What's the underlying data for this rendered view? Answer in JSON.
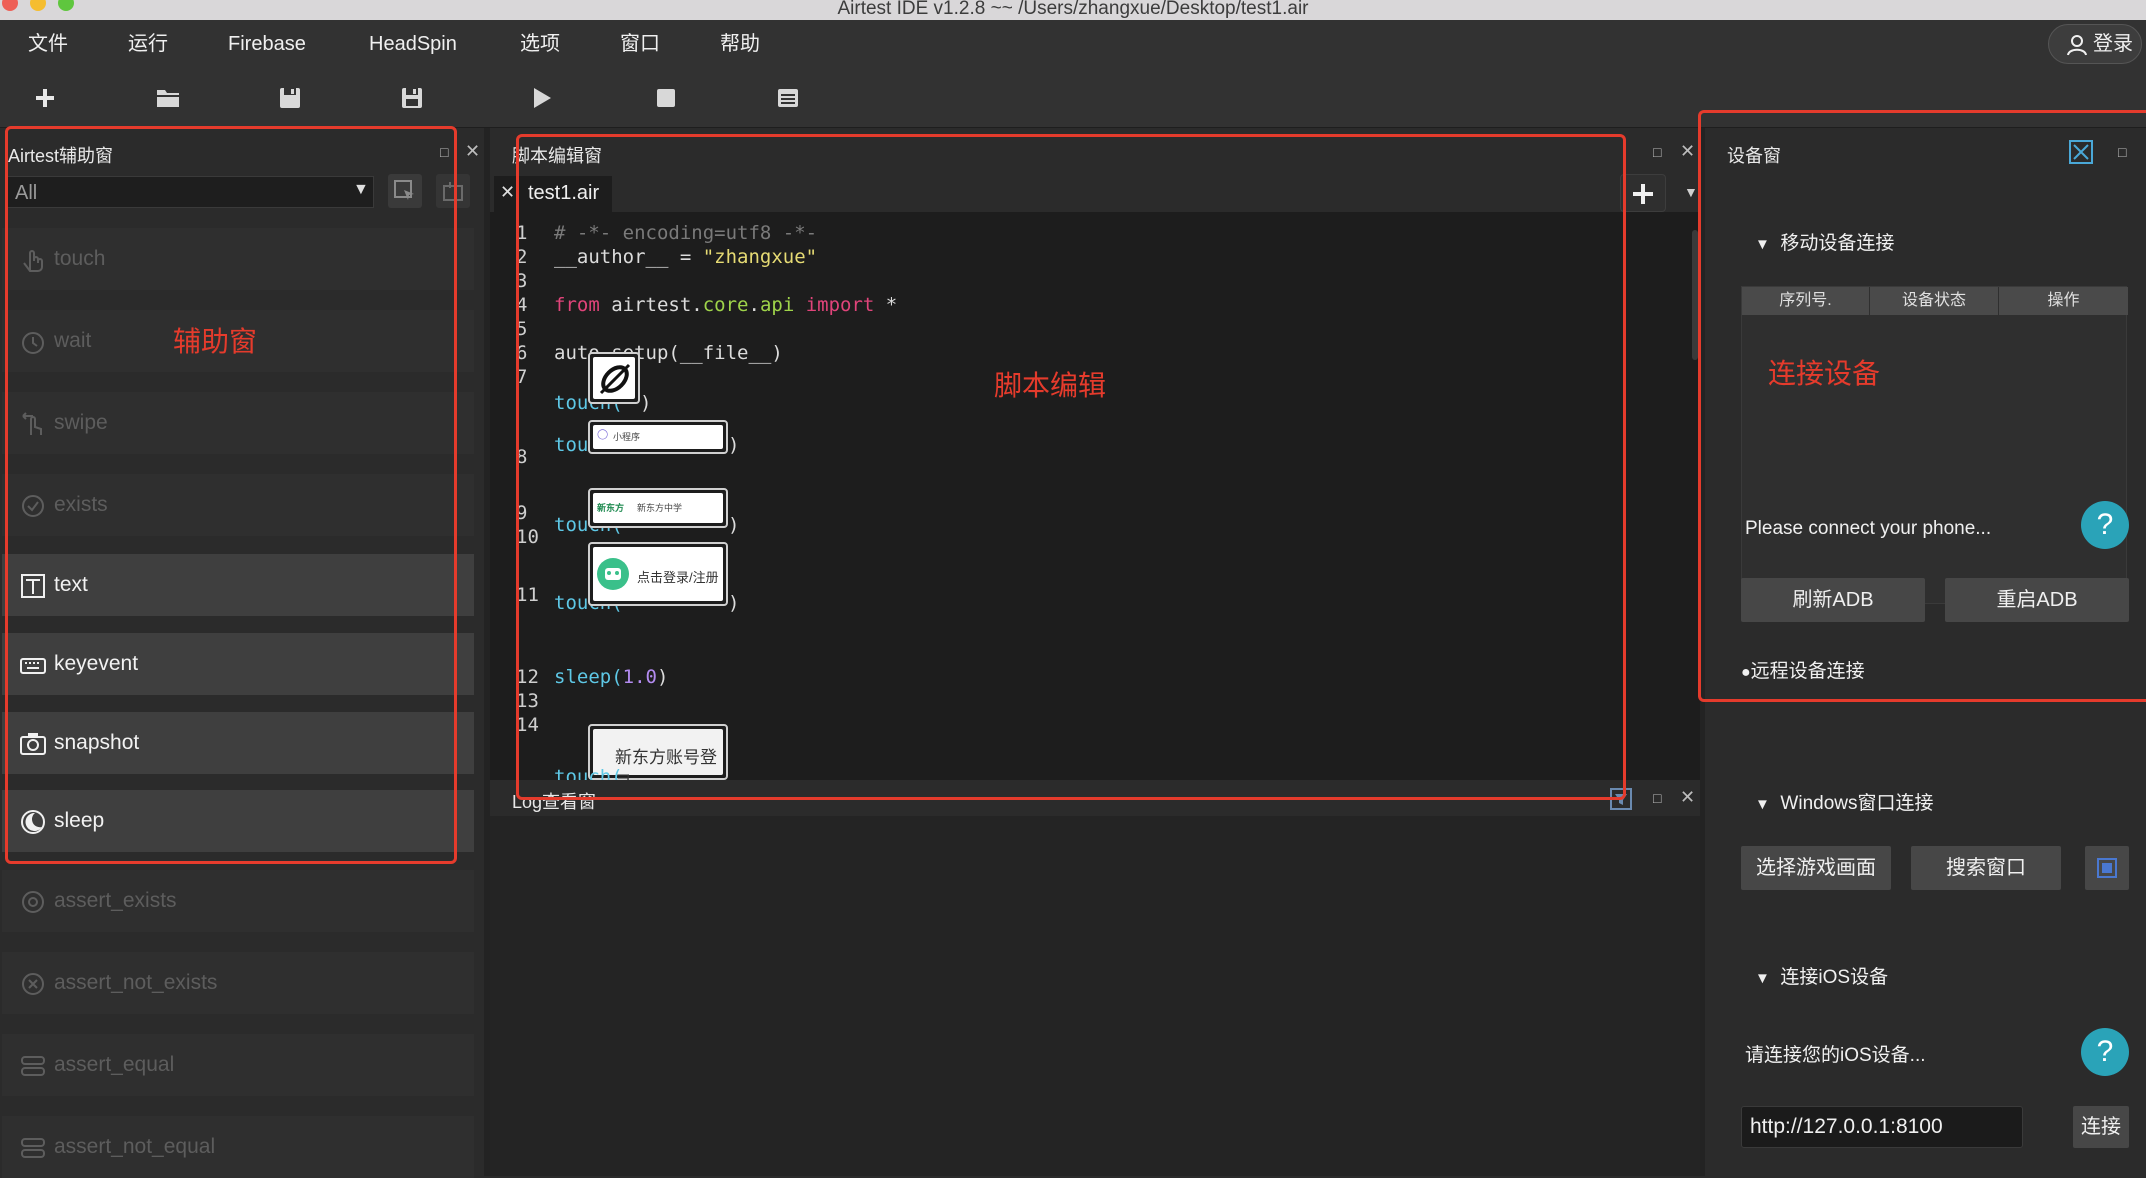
{
  "window": {
    "title": "Airtest IDE v1.2.8 ~~ /Users/zhangxue/Desktop/test1.air"
  },
  "menu": [
    "文件",
    "运行",
    "Firebase",
    "HeadSpin",
    "选项",
    "窗口",
    "帮助"
  ],
  "login_label": "登录",
  "toolbar": [
    "new-icon",
    "open-folder-icon",
    "save-icon",
    "save-as-icon",
    "play-icon",
    "stop-icon",
    "list-icon"
  ],
  "helper": {
    "title": "Airtest辅助窗",
    "filter_value": "All",
    "items": [
      {
        "label": "touch",
        "active": false,
        "icon": "hand-icon"
      },
      {
        "label": "wait",
        "active": false,
        "icon": "clock-icon"
      },
      {
        "label": "swipe",
        "active": false,
        "icon": "swipe-icon"
      },
      {
        "label": "exists",
        "active": false,
        "icon": "check-circle-icon"
      },
      {
        "label": "text",
        "active": true,
        "icon": "text-icon"
      },
      {
        "label": "keyevent",
        "active": true,
        "icon": "keyboard-icon"
      },
      {
        "label": "snapshot",
        "active": true,
        "icon": "camera-icon"
      },
      {
        "label": "sleep",
        "active": true,
        "icon": "moon-icon"
      },
      {
        "label": "assert_exists",
        "active": false,
        "icon": "target-icon"
      },
      {
        "label": "assert_not_exists",
        "active": false,
        "icon": "x-circle-icon"
      },
      {
        "label": "assert_equal",
        "active": false,
        "icon": "equal-icon"
      },
      {
        "label": "assert_not_equal",
        "active": false,
        "icon": "not-equal-icon"
      }
    ],
    "annotation": "辅助窗"
  },
  "editor": {
    "title": "脚本编辑窗",
    "tab": "test1.air",
    "annotation": "脚本编辑",
    "line_numbers": [
      "1",
      "2",
      "3",
      "4",
      "5",
      "6",
      "7",
      "8",
      "9",
      "10",
      "11",
      "12",
      "13",
      "14"
    ],
    "code": {
      "l1": "# -*- encoding=utf8 -*-",
      "l2_a": "__author__ = ",
      "l2_b": "\"zhangxue\"",
      "l4_a": "from",
      "l4_b": " airtest.",
      "l4_c": "core",
      "l4_d": ".",
      "l4_e": "api",
      "l4_f": " import",
      "l4_g": " *",
      "l6": "auto_setup(__file__)",
      "touch": "touch(",
      "close_paren": ")",
      "sleep_a": "sleep(",
      "sleep_b": "1.0",
      "sleep_c": ")"
    },
    "thumbs": {
      "t2": "小程序",
      "t3_logo": "新东方",
      "t3": "新东方中学",
      "t4": "点击登录/注册",
      "t5": "新东方账号登录"
    }
  },
  "log": {
    "title": "Log查看窗"
  },
  "device": {
    "title": "设备窗",
    "mobile_section": "移动设备连接",
    "table_headers": [
      "序列号.",
      "设备状态",
      "操作"
    ],
    "annotation": "连接设备",
    "connect_hint": "Please connect your phone...",
    "refresh_adb": "刷新ADB",
    "restart_adb": "重启ADB",
    "remote_section": "远程设备连接",
    "windows_section": "Windows窗口连接",
    "select_game": "选择游戏画面",
    "search_window": "搜索窗口",
    "ios_section": "连接iOS设备",
    "ios_hint": "请连接您的iOS设备...",
    "ios_url": "http://127.0.0.1:8100",
    "connect": "连接",
    "help": "?"
  },
  "colors": {
    "annotation_red": "#e53b2c",
    "panel_bg": "#2b2b2b",
    "code_bg": "#1d1d1d"
  }
}
